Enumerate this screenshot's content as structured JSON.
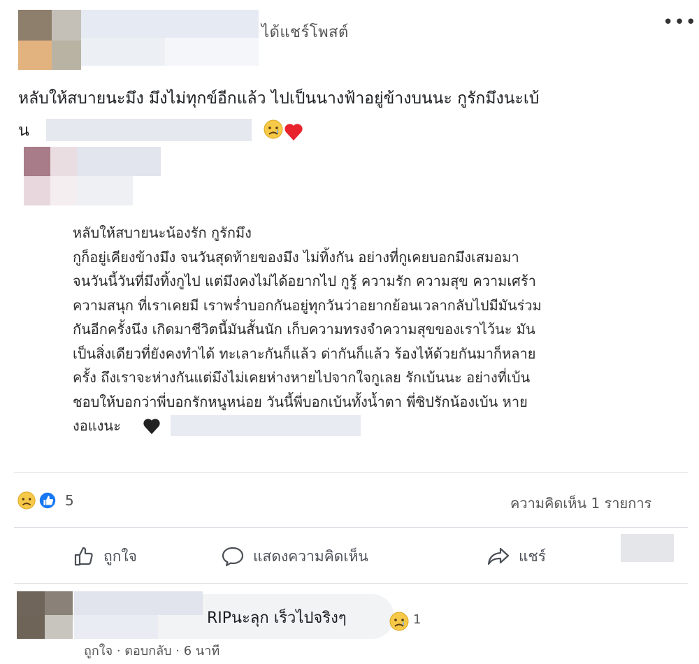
{
  "header": {
    "shared_label": "ได้แชร์โพสต์",
    "more_label": "•••"
  },
  "post": {
    "text_line1": "หลับให้สบายนะมึง มึงไม่ทุกข์อีกแล้ว ไปเป็นนางฟ้าอยู่ข้างบนนะ กูรักมึงนะเบ้",
    "text_line2_start": "น",
    "emojis": [
      "sad-face",
      "red-heart"
    ]
  },
  "shared_card": {
    "lines": [
      "หลับให้สบายนะน้องรัก กูรักมึง",
      "กูก็อยู่เคียงข้างมึง จนวันสุดท้ายของมึง ไม่ทิ้งกัน อย่างที่กูเคยบอกมึงเสมอมา",
      "จนวันนี้วันที่มึงทิ้งกูไป แต่มึงคงไม่ได้อยากไป กูรู้ ความรัก ความสุข ความเศร้า",
      "ความสนุก ที่เราเคยมี เราพร่ำบอกกันอยู่ทุกวันว่าอยากย้อนเวลากลับไปมีมันร่วม",
      "กันอีกครั้งนึง เกิดมาชีวิตนี้มันสั้นนัก เก็บความทรงจำความสุขของเราไว้นะ มัน",
      "เป็นสิ่งเดียวที่ยังคงทำได้ ทะเลาะกันก็แล้ว ด่ากันก็แล้ว ร้องไห้ด้วยกันมาก็หลาย",
      "ครั้ง ถึงเราจะห่างกันแต่มึงไม่เคยห่างหายไปจากใจกูเลย รักเบ้นนะ อย่างที่เบ้น",
      "ชอบให้บอกว่าพี่บอกรักหนูหน่อย วันนี้พี่บอกเบ้นทั้งน้ำตา พี่ซิปรักน้องเบ้น หาย",
      "งอแงนะ"
    ],
    "end_emoji": "black-heart"
  },
  "reactions": {
    "count": "5",
    "comment_count_label": "ความคิดเห็น 1 รายการ"
  },
  "actions": {
    "like_label": "ถูกใจ",
    "comment_label": "แสดงความคิดเห็น",
    "share_label": "แชร์"
  },
  "comment": {
    "text": "RIPนะลุก เร็วไปจริงๆ",
    "reaction_count": "1",
    "meta": "ถูกใจ · ตอบกลับ · 6 นาที"
  },
  "colors": {
    "text": "#1c1e21",
    "muted": "#555555",
    "divider": "#dadde1",
    "like_blue": "#1877f2",
    "sad_yellow": "#f7c948",
    "heart_red": "#e8232b"
  }
}
